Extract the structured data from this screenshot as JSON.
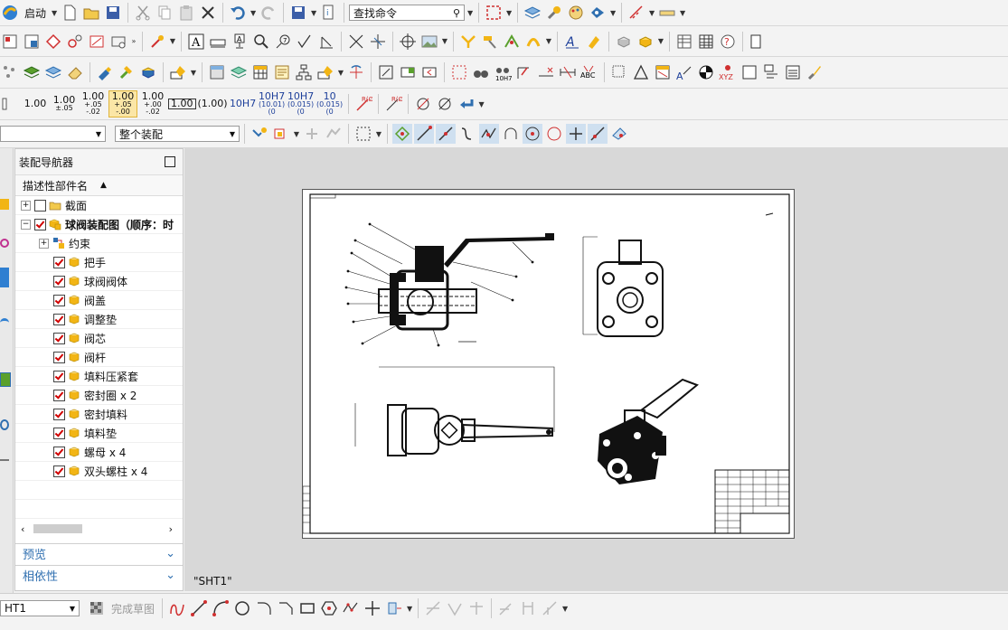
{
  "toolbar1": {
    "start_label": "启动",
    "search": {
      "value": "",
      "placeholder": "查找命令"
    }
  },
  "toolbar4": {
    "tolerances": [
      {
        "main": "1.00",
        "sub1": "",
        "sub2": ""
      },
      {
        "main": "1.00",
        "sub1": "±.05",
        "sub2": ""
      },
      {
        "main": "1.00",
        "sub1": "+.05",
        "sub2": "-.02"
      },
      {
        "main": "1.00",
        "sub1": "+.05",
        "sub2": "-.00"
      },
      {
        "main": "1.00",
        "sub1": "+.00",
        "sub2": "-.02"
      }
    ],
    "boxed_value": "1.00",
    "paren_value": "(1.00)",
    "fit": "10H7",
    "fit_a": {
      "main": "10H7",
      "sub": "(10.01)",
      "sub2": "(0"
    },
    "fit_b": {
      "main": "10H7",
      "sub": "(0.015)",
      "sub2": "(0"
    },
    "fit_c": {
      "main": "10",
      "sub": "(0.015)",
      "sub2": "(0"
    }
  },
  "toolbar5": {
    "filter_select": "",
    "assembly_select": "整个装配"
  },
  "navigator": {
    "title": "装配导航器",
    "column_header": "描述性部件名",
    "items": [
      {
        "label": "截面",
        "indent": 1,
        "expander": "+",
        "checked": false,
        "kind": "folder"
      },
      {
        "label": "球阀装配图（顺序：时",
        "indent": 1,
        "expander": "−",
        "checked": true,
        "kind": "assembly",
        "bold": true
      },
      {
        "label": "约束",
        "indent": 2,
        "expander": "+",
        "checked": null,
        "kind": "constraint"
      },
      {
        "label": "把手",
        "indent": 3,
        "checked": true,
        "kind": "part"
      },
      {
        "label": "球阀阀体",
        "indent": 3,
        "checked": true,
        "kind": "part"
      },
      {
        "label": "阀盖",
        "indent": 3,
        "checked": true,
        "kind": "part"
      },
      {
        "label": "调整垫",
        "indent": 3,
        "checked": true,
        "kind": "part"
      },
      {
        "label": "阀芯",
        "indent": 3,
        "checked": true,
        "kind": "part"
      },
      {
        "label": "阀杆",
        "indent": 3,
        "checked": true,
        "kind": "part"
      },
      {
        "label": "填料压紧套",
        "indent": 3,
        "checked": true,
        "kind": "part"
      },
      {
        "label": "密封圈 x 2",
        "indent": 3,
        "checked": true,
        "kind": "part"
      },
      {
        "label": "密封填料",
        "indent": 3,
        "checked": true,
        "kind": "part"
      },
      {
        "label": "填料垫",
        "indent": 3,
        "checked": true,
        "kind": "part"
      },
      {
        "label": "螺母 x 4",
        "indent": 3,
        "checked": true,
        "kind": "part"
      },
      {
        "label": "双头螺柱 x 4",
        "indent": 3,
        "checked": true,
        "kind": "part"
      }
    ],
    "preview_label": "预览",
    "dependency_label": "相依性"
  },
  "canvas": {
    "sheet_name": "\"SHT1\""
  },
  "bottombar": {
    "sheet_select": "HT1",
    "finish_sketch_label": "完成草图"
  },
  "colors": {
    "accent_blue": "#2f6fb0",
    "check_red": "#d00000",
    "part_yellow": "#f2b515",
    "canvas_gray": "#d8d8d8"
  }
}
